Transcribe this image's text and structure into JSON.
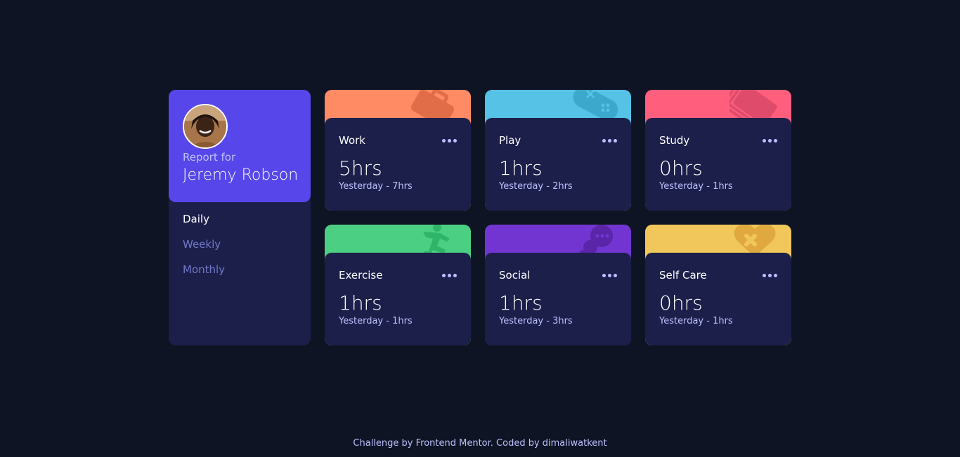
{
  "profile": {
    "report_for": "Report for",
    "name": "Jeremy Robson",
    "periods": [
      {
        "label": "Daily",
        "active": true
      },
      {
        "label": "Weekly",
        "active": false
      },
      {
        "label": "Monthly",
        "active": false
      }
    ]
  },
  "activities": [
    {
      "title": "Work",
      "current": "5hrs",
      "previous": "Yesterday - 7hrs",
      "color": "#ff8b64",
      "icon": "briefcase-icon"
    },
    {
      "title": "Play",
      "current": "1hrs",
      "previous": "Yesterday - 2hrs",
      "color": "#55c2e6",
      "icon": "gamepad-icon"
    },
    {
      "title": "Study",
      "current": "0hrs",
      "previous": "Yesterday - 1hrs",
      "color": "#ff5e7d",
      "icon": "book-icon"
    },
    {
      "title": "Exercise",
      "current": "1hrs",
      "previous": "Yesterday - 1hrs",
      "color": "#4bcf82",
      "icon": "running-icon"
    },
    {
      "title": "Social",
      "current": "1hrs",
      "previous": "Yesterday - 3hrs",
      "color": "#7335d2",
      "icon": "chat-icon"
    },
    {
      "title": "Self Care",
      "current": "0hrs",
      "previous": "Yesterday - 1hrs",
      "color": "#f1c75b",
      "icon": "heart-icon"
    }
  ],
  "footer": {
    "text": "Challenge by Frontend Mentor. Coded by dimaliwatkent"
  }
}
